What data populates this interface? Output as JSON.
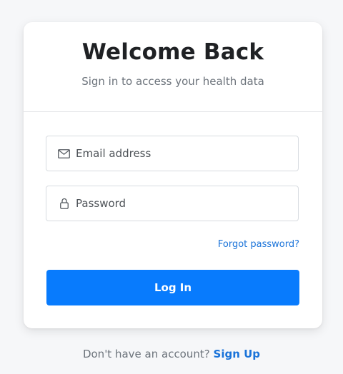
{
  "header": {
    "title": "Welcome Back",
    "subtitle": "Sign in to access your health data"
  },
  "form": {
    "email": {
      "placeholder": "Email address",
      "value": "",
      "icon": "envelope-icon"
    },
    "password": {
      "placeholder": "Password",
      "value": "",
      "icon": "lock-icon"
    },
    "forgot_label": "Forgot password?",
    "login_label": "Log In"
  },
  "footer": {
    "prompt": "Don't have an account?",
    "signup_label": "Sign Up"
  },
  "colors": {
    "primary": "#087bfd",
    "link": "#1a73d9",
    "background": "#f6f7f9",
    "card": "#ffffff"
  }
}
